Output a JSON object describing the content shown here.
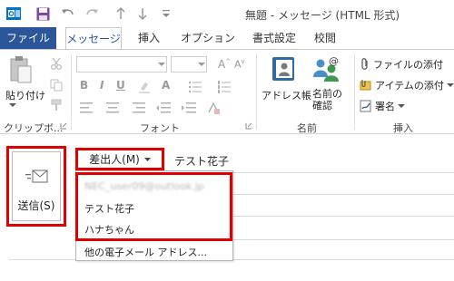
{
  "window": {
    "title": "無題 - メッセージ (HTML 形式)"
  },
  "ribbon_tabs": [
    {
      "label": "ファイル"
    },
    {
      "label": "メッセージ"
    },
    {
      "label": "挿入"
    },
    {
      "label": "オプション"
    },
    {
      "label": "書式設定"
    },
    {
      "label": "校閲"
    }
  ],
  "groups": {
    "clipboard": {
      "label": "クリップボ...",
      "paste_label": "貼り付け"
    },
    "font": {
      "label": "フォント"
    },
    "names": {
      "label": "名前",
      "address_book_label": "アドレス帳",
      "check_names_label": "名前の確認"
    },
    "include": {
      "label": "挿入",
      "attach_file_label": "ファイルの添付",
      "attach_item_label": "アイテムの添付",
      "signature_label": "署名"
    }
  },
  "compose": {
    "send_label": "送信(S)",
    "from_label": "差出人(M)",
    "from_name": "テスト花子"
  },
  "from_menu": {
    "items": [
      {
        "label": "NEC_user09@outlook.jp"
      },
      {
        "label": "テスト花子"
      },
      {
        "label": "ハナちゃん"
      }
    ],
    "other_label": "他の電子メール アドレス..."
  },
  "colors": {
    "accent": "#2b579a",
    "highlight": "#e00000"
  }
}
